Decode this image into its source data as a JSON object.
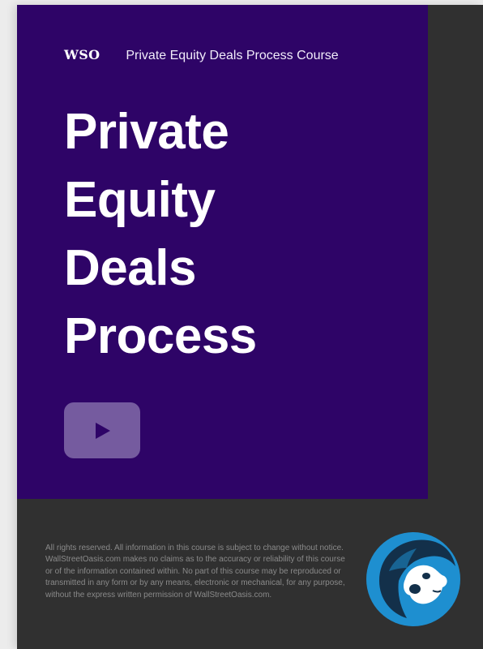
{
  "brand": {
    "logo": "WSO",
    "course_label": "Private Equity Deals Process Course"
  },
  "cover": {
    "title_lines": [
      "Private",
      "Equity",
      "Deals",
      "Process"
    ],
    "play_icon": "play-icon"
  },
  "footer": {
    "legal": "All rights reserved. All information in this course is subject to change without notice. WallStreetOasis.com makes no claims as to the accuracy or reliability of this course or of the information contained within. No part of this course may be reproduced or transmitted in any form or by any means, electronic or mechanical, for any purpose, without the express written permission of WallStreetOasis.com.",
    "mascot_icon": "monkey-mascot-icon"
  },
  "colors": {
    "cover_background": "#2e0467",
    "footer_background": "#303030",
    "play_button": "#755b9f",
    "mascot_blue": "#1e8fd0",
    "mascot_dark": "#13304a"
  }
}
